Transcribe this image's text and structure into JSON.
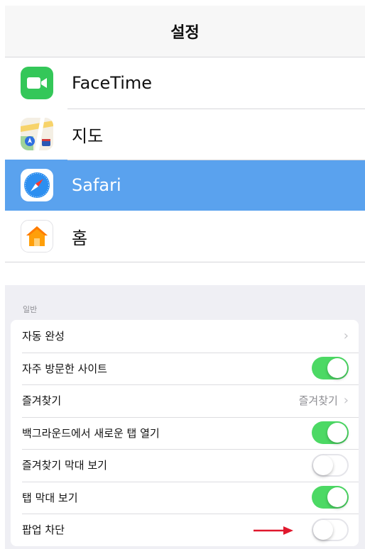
{
  "nav": {
    "title": "설정"
  },
  "apps": [
    {
      "label": "FaceTime",
      "icon": "facetime-icon",
      "selected": false
    },
    {
      "label": "지도",
      "icon": "maps-icon",
      "selected": false
    },
    {
      "label": "Safari",
      "icon": "safari-compass-icon",
      "selected": true
    },
    {
      "label": "홈",
      "icon": "home-icon",
      "selected": false
    }
  ],
  "section": {
    "header": "일반",
    "rows": [
      {
        "label": "자동 완성",
        "type": "disclosure",
        "value": ""
      },
      {
        "label": "자주 방문한 사이트",
        "type": "toggle",
        "on": true
      },
      {
        "label": "즐겨찾기",
        "type": "disclosure",
        "value": "즐겨찾기"
      },
      {
        "label": "백그라운드에서 새로운 탭 열기",
        "type": "toggle",
        "on": true
      },
      {
        "label": "즐겨찾기 막대 보기",
        "type": "toggle",
        "on": false
      },
      {
        "label": "탭 막대 보기",
        "type": "toggle",
        "on": true
      },
      {
        "label": "팝업 차단",
        "type": "toggle",
        "on": false
      }
    ]
  },
  "chevron_glyph": "›",
  "colors": {
    "selected_row": "#5aa2ee",
    "toggle_on": "#4cd964",
    "annotation_arrow": "#e0182d",
    "group_background": "#efeff4"
  }
}
